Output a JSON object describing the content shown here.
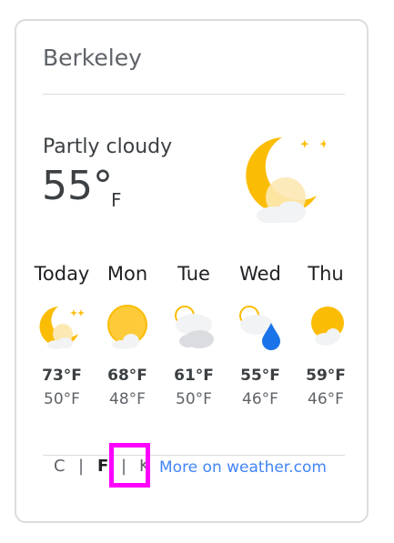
{
  "location": "Berkeley",
  "current": {
    "condition": "Partly cloudy",
    "temp": "55°",
    "unit": "F",
    "icon": "moon-cloud-icon"
  },
  "forecast": [
    {
      "day": "Today",
      "high": "73°F",
      "low": "50°F",
      "icon": "moon-stars-cloud-icon"
    },
    {
      "day": "Mon",
      "high": "68°F",
      "low": "48°F",
      "icon": "sun-cloud-icon"
    },
    {
      "day": "Tue",
      "high": "61°F",
      "low": "50°F",
      "icon": "cloudy-icon"
    },
    {
      "day": "Wed",
      "high": "55°F",
      "low": "46°F",
      "icon": "rain-icon"
    },
    {
      "day": "Thu",
      "high": "59°F",
      "low": "46°F",
      "icon": "sun-cloud-icon"
    }
  ],
  "units": {
    "c": "C",
    "f": "F",
    "k": "K",
    "separator": "|",
    "active": "F"
  },
  "more_link": "More on weather.com",
  "colors": {
    "highlight": "#ff00ff",
    "link": "#4285f4",
    "sun": "#fbbc04"
  }
}
